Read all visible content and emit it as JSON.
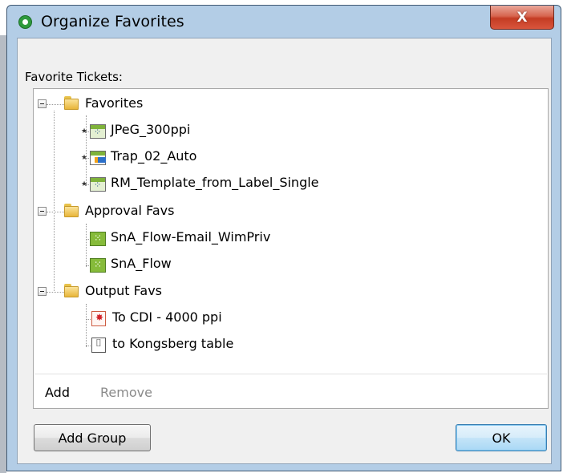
{
  "window": {
    "title": "Organize Favorites",
    "close_label": "X"
  },
  "section_label": "Favorite Tickets:",
  "tree": {
    "groups": [
      {
        "label": "Favorites",
        "items": [
          {
            "label": "JPeG_300ppi",
            "icon": "grid-ticket-icon"
          },
          {
            "label": "Trap_02_Auto",
            "icon": "trap-ticket-icon"
          },
          {
            "label": "RM_Template_from_Label_Single",
            "icon": "grid-ticket-icon"
          }
        ]
      },
      {
        "label": "Approval Favs",
        "items": [
          {
            "label": "SnA_Flow-Email_WimPriv",
            "icon": "flow-icon"
          },
          {
            "label": "SnA_Flow",
            "icon": "flow-icon"
          }
        ]
      },
      {
        "label": "Output Favs",
        "items": [
          {
            "label": "To CDI - 4000 ppi",
            "icon": "cdi-icon"
          },
          {
            "label": "to Kongsberg table",
            "icon": "kongsberg-icon"
          }
        ]
      }
    ]
  },
  "actions": {
    "add_label": "Add",
    "remove_label": "Remove"
  },
  "buttons": {
    "add_group_label": "Add Group",
    "ok_label": "OK"
  }
}
